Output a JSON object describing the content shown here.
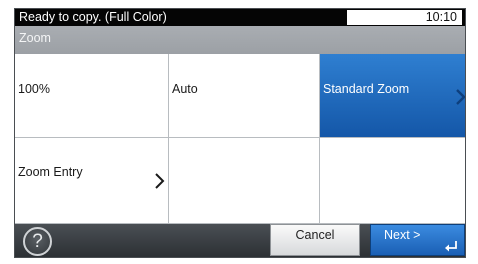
{
  "status_bar": {
    "message": "Ready to copy. (Full Color)",
    "time": "10:10"
  },
  "title": "Zoom",
  "options": [
    {
      "label": "100%",
      "selected": false,
      "has_submenu": false
    },
    {
      "label": "Auto",
      "selected": false,
      "has_submenu": false
    },
    {
      "label": "Standard Zoom",
      "selected": true,
      "has_submenu": true
    },
    {
      "label": "Zoom Entry",
      "selected": false,
      "has_submenu": true
    },
    {
      "label": "",
      "selected": false,
      "has_submenu": false
    },
    {
      "label": "",
      "selected": false,
      "has_submenu": false
    }
  ],
  "bottom_bar": {
    "help_symbol": "?",
    "cancel_label": "Cancel",
    "next_label": "Next >"
  },
  "colors": {
    "selected_blue": "#1f6cc0",
    "title_bar_gray": "#a3a7ac",
    "status_bar_black": "#050505"
  },
  "icons": [
    "chevron-right-icon",
    "help-icon",
    "enter-icon"
  ]
}
